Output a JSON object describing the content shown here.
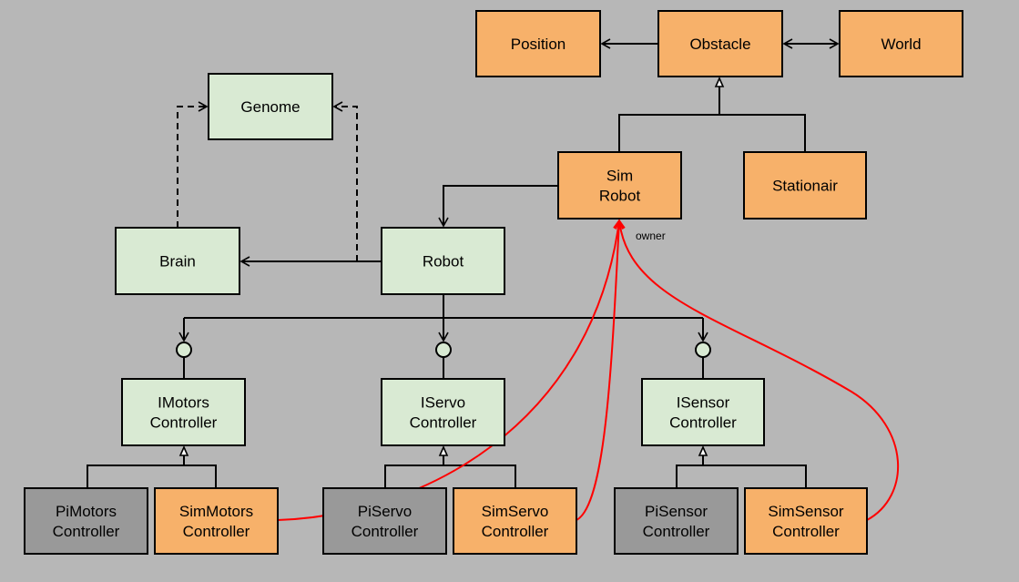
{
  "colors": {
    "background": "#b7b7b7",
    "simulation": "#f7b16a",
    "core": "#d9ead3",
    "hardware": "#999999",
    "owner_link": "#ff0000"
  },
  "nodes": {
    "position": {
      "lines": [
        "Position"
      ],
      "kind": "simulation"
    },
    "obstacle": {
      "lines": [
        "Obstacle"
      ],
      "kind": "simulation"
    },
    "world": {
      "lines": [
        "World"
      ],
      "kind": "simulation"
    },
    "genome": {
      "lines": [
        "Genome"
      ],
      "kind": "core"
    },
    "simrobot": {
      "lines": [
        "Sim",
        "Robot"
      ],
      "kind": "simulation"
    },
    "stationair": {
      "lines": [
        "Stationair"
      ],
      "kind": "simulation"
    },
    "brain": {
      "lines": [
        "Brain"
      ],
      "kind": "core"
    },
    "robot": {
      "lines": [
        "Robot"
      ],
      "kind": "core"
    },
    "imotors": {
      "lines": [
        "IMotors",
        "Controller"
      ],
      "kind": "core"
    },
    "iservo": {
      "lines": [
        "IServo",
        "Controller"
      ],
      "kind": "core"
    },
    "isensor": {
      "lines": [
        "ISensor",
        "Controller"
      ],
      "kind": "core"
    },
    "pimotors": {
      "lines": [
        "PiMotors",
        "Controller"
      ],
      "kind": "hardware"
    },
    "simmotors": {
      "lines": [
        "SimMotors",
        "Controller"
      ],
      "kind": "simulation"
    },
    "piservo": {
      "lines": [
        "PiServo",
        "Controller"
      ],
      "kind": "hardware"
    },
    "simservo": {
      "lines": [
        "SimServo",
        "Controller"
      ],
      "kind": "simulation"
    },
    "pisensor": {
      "lines": [
        "PiSensor",
        "Controller"
      ],
      "kind": "hardware"
    },
    "simsensor": {
      "lines": [
        "SimSensor",
        "Controller"
      ],
      "kind": "simulation"
    }
  },
  "edges": [
    {
      "from": "obstacle",
      "to": "position",
      "type": "association"
    },
    {
      "from": "obstacle",
      "to": "world",
      "type": "bidirectional"
    },
    {
      "from": "simrobot",
      "to": "obstacle",
      "type": "inheritance"
    },
    {
      "from": "stationair",
      "to": "obstacle",
      "type": "inheritance"
    },
    {
      "from": "simrobot",
      "to": "robot",
      "type": "association"
    },
    {
      "from": "robot",
      "to": "brain",
      "type": "association"
    },
    {
      "from": "brain",
      "to": "genome",
      "type": "dependency"
    },
    {
      "from": "robot",
      "to": "genome",
      "type": "dependency"
    },
    {
      "from": "robot",
      "to": "imotors",
      "type": "interface"
    },
    {
      "from": "robot",
      "to": "iservo",
      "type": "interface"
    },
    {
      "from": "robot",
      "to": "isensor",
      "type": "interface"
    },
    {
      "from": "pimotors",
      "to": "imotors",
      "type": "inheritance"
    },
    {
      "from": "simmotors",
      "to": "imotors",
      "type": "inheritance"
    },
    {
      "from": "piservo",
      "to": "iservo",
      "type": "inheritance"
    },
    {
      "from": "simservo",
      "to": "iservo",
      "type": "inheritance"
    },
    {
      "from": "pisensor",
      "to": "isensor",
      "type": "inheritance"
    },
    {
      "from": "simsensor",
      "to": "isensor",
      "type": "inheritance"
    },
    {
      "from": "simmotors",
      "to": "simrobot",
      "type": "owner"
    },
    {
      "from": "simservo",
      "to": "simrobot",
      "type": "owner"
    },
    {
      "from": "simsensor",
      "to": "simrobot",
      "type": "owner"
    }
  ],
  "owner_label": "owner"
}
